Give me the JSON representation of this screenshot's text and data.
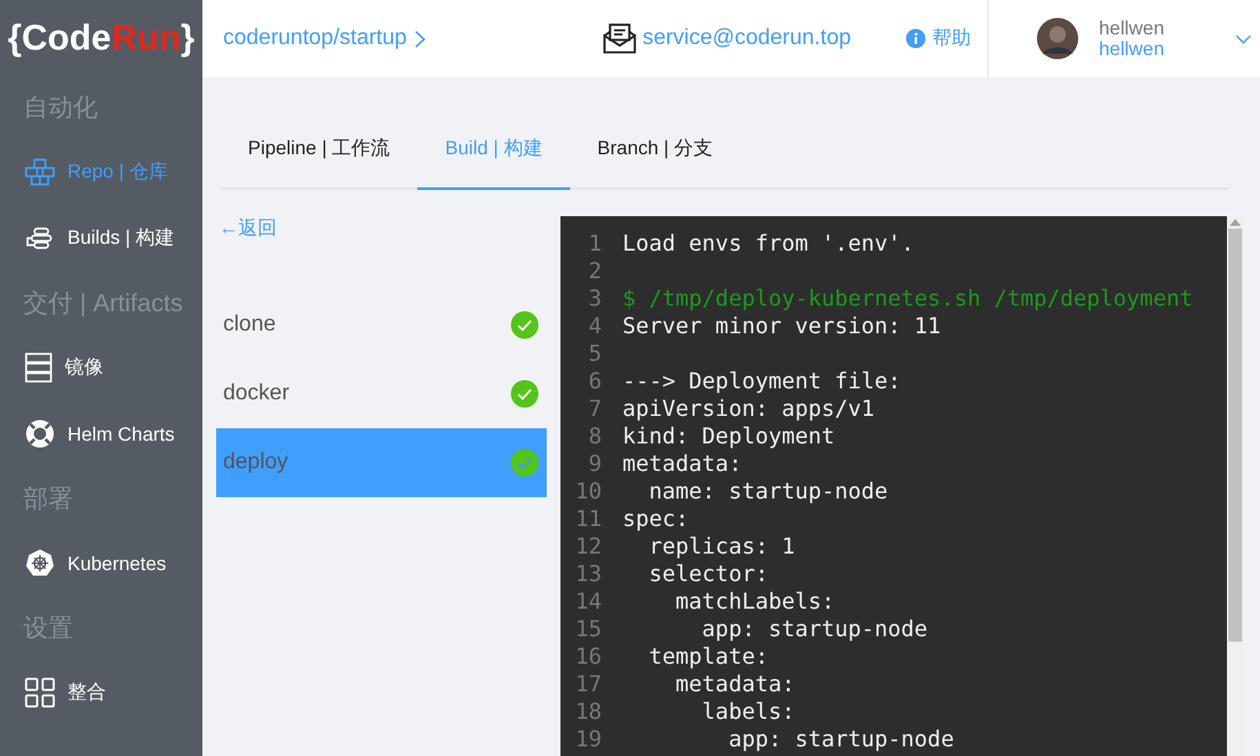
{
  "logo": {
    "left": "{Code",
    "right": "Run",
    "close": "}"
  },
  "sidebar": {
    "items": [
      {
        "kind": "section",
        "label": "自动化"
      },
      {
        "kind": "item",
        "label": "Repo | 仓库",
        "selected": true
      },
      {
        "kind": "item",
        "label": "Builds | 构建",
        "selected": false
      },
      {
        "kind": "section",
        "label": "交付 | Artifacts"
      },
      {
        "kind": "item",
        "label": "镜像",
        "selected": false
      },
      {
        "kind": "item",
        "label": "Helm Charts",
        "selected": false
      },
      {
        "kind": "section",
        "label": "部署"
      },
      {
        "kind": "item",
        "label": "Kubernetes",
        "selected": false
      },
      {
        "kind": "section",
        "label": "设置"
      },
      {
        "kind": "item",
        "label": "整合",
        "selected": false
      }
    ]
  },
  "header": {
    "breadcrumb": "coderuntop/startup",
    "email": "service@coderun.top",
    "help": "帮助",
    "user": {
      "name": "hellwen",
      "login": "hellwen"
    }
  },
  "tabs": [
    {
      "label": "Pipeline | 工作流",
      "selected": false
    },
    {
      "label": "Build | 构建",
      "selected": true
    },
    {
      "label": "Branch | 分支",
      "selected": false
    }
  ],
  "back": "←返回",
  "steps": [
    {
      "name": "clone",
      "done": true,
      "selected": false
    },
    {
      "name": "docker",
      "done": true,
      "selected": false
    },
    {
      "name": "deploy",
      "done": true,
      "selected": true
    }
  ],
  "log": [
    {
      "n": "1",
      "text": "Load envs from '.env'.",
      "kind": "output"
    },
    {
      "n": "2"
    },
    {
      "n": "3",
      "text": "$ /tmp/deploy-kubernetes.sh /tmp/deployment",
      "kind": "command"
    },
    {
      "n": "4",
      "text": "Server minor version: 11",
      "kind": "output"
    },
    {
      "n": "5"
    },
    {
      "n": "6",
      "text": "---> Deployment file:",
      "kind": "output"
    },
    {
      "n": "7",
      "text": "apiVersion: apps/v1",
      "kind": "output"
    },
    {
      "n": "8",
      "text": "kind: Deployment",
      "kind": "output"
    },
    {
      "n": "9",
      "text": "metadata:",
      "kind": "output"
    },
    {
      "n": "10",
      "text": "  name: startup-node",
      "kind": "output"
    },
    {
      "n": "11",
      "text": "spec:",
      "kind": "output"
    },
    {
      "n": "12",
      "text": "  replicas: 1",
      "kind": "output"
    },
    {
      "n": "13",
      "text": "  selector:",
      "kind": "output"
    },
    {
      "n": "14",
      "text": "    matchLabels:",
      "kind": "output"
    },
    {
      "n": "15",
      "text": "      app: startup-node",
      "kind": "output"
    },
    {
      "n": "16",
      "text": "  template:",
      "kind": "output"
    },
    {
      "n": "17",
      "text": "    metadata:",
      "kind": "output"
    },
    {
      "n": "18",
      "text": "      labels:",
      "kind": "output"
    },
    {
      "n": "19",
      "text": "        app: startup-node",
      "kind": "output"
    }
  ]
}
